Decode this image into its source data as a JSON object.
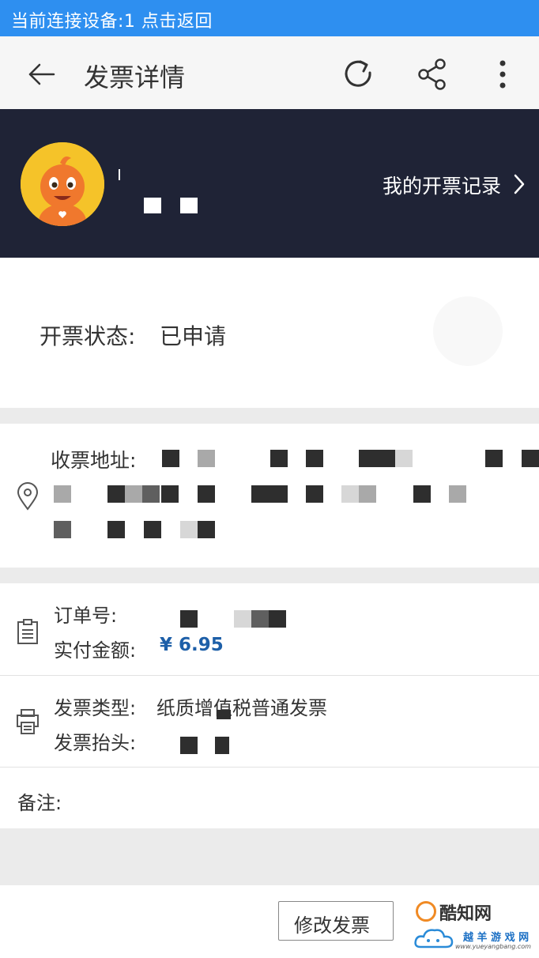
{
  "connection_bar": {
    "text": "当前连接设备:1 点击返回",
    "color": "#2e8ff0"
  },
  "app_bar": {
    "title": "发票详情",
    "icons": [
      "back-arrow-icon",
      "refresh-icon",
      "share-icon",
      "more-vertical-icon"
    ]
  },
  "profile": {
    "records_link": "我的开票记录",
    "background": "#1f2336",
    "avatar_color": "#f5c329"
  },
  "status": {
    "label": "开票状态:",
    "value": "已申请"
  },
  "address": {
    "label": "收票地址:"
  },
  "order": {
    "order_no_label": "订单号:",
    "paid_label": "实付金额:",
    "paid_value": "¥ 6.95",
    "paid_color": "#1d5fa8"
  },
  "invoice": {
    "type_label": "发票类型:",
    "type_value": "纸质增值税普通发票",
    "title_label": "发票抬头:"
  },
  "remark": {
    "label": "备注:"
  },
  "bottom": {
    "modify_button": "修改发票"
  },
  "watermark": {
    "logo_text": "酷知网",
    "brand": "越 羊 游 戏 网",
    "url": "www.yueyangbang.com"
  }
}
